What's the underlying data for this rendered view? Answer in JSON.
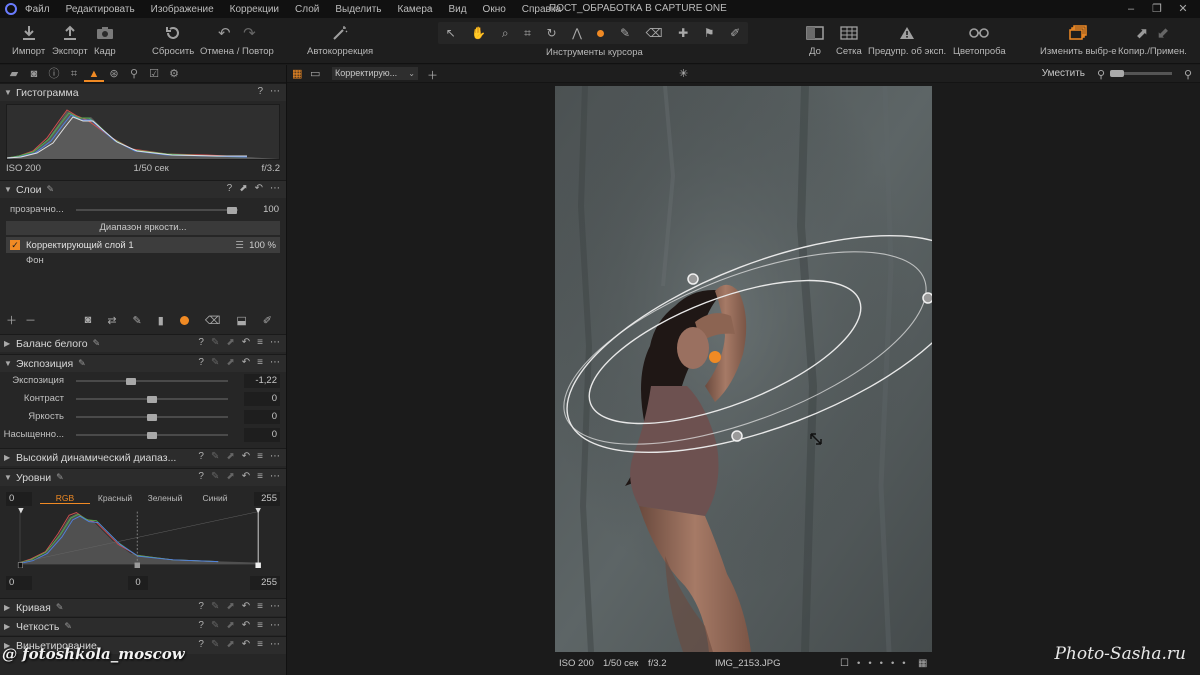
{
  "menu": {
    "items": [
      "Файл",
      "Редактировать",
      "Изображение",
      "Коррекции",
      "Слой",
      "Выделить",
      "Камера",
      "Вид",
      "Окно",
      "Справка"
    ],
    "window_title": "ПОСТ_ОБРАБОТКА В CAPTURE ONE",
    "window_controls": [
      "–",
      "❐",
      "✕"
    ]
  },
  "toolbar": {
    "import": "Импорт",
    "export": "Экспорт",
    "capture": "Кадр",
    "reset": "Сбросить",
    "undo_redo": "Отмена / Повтор",
    "autocorrect": "Автокоррекция",
    "cursor_tools": "Инструменты курсора",
    "before": "До",
    "grid": "Сетка",
    "exposure_warning": "Предупр. об эксп.",
    "color_readout": "Цветопроба",
    "edit_selected": "Изменить выбр-е",
    "copy_apply": "Копир./Примен."
  },
  "histogram": {
    "title": "Гистограмма",
    "iso": "ISO 200",
    "shutter": "1/50 сек",
    "aperture": "f/3.2"
  },
  "layers": {
    "title": "Слои",
    "opacity_label": "прозрачно...",
    "opacity_value": "100",
    "opacity_fraction": 0.96,
    "luma_range_button": "Диапазон яркости...",
    "layer_1_name": "Корректирующий слой 1",
    "layer_1_opacity": "100 %",
    "background_name": "Фон"
  },
  "white_balance": {
    "title": "Баланс белого"
  },
  "exposure": {
    "title": "Экспозиция",
    "rows": [
      {
        "label": "Экспозиция",
        "value": "-1,22",
        "fraction": 0.36
      },
      {
        "label": "Контраст",
        "value": "0",
        "fraction": 0.5
      },
      {
        "label": "Яркость",
        "value": "0",
        "fraction": 0.5
      },
      {
        "label": "Насыщенно...",
        "value": "0",
        "fraction": 0.5
      }
    ]
  },
  "hdr": {
    "title": "Высокий динамический диапаз..."
  },
  "levels": {
    "title": "Уровни",
    "input_left": "0",
    "input_right": "255",
    "tabs": [
      "RGB",
      "Красный",
      "Зеленый",
      "Синий"
    ],
    "active_tab": "RGB",
    "output_left": "0",
    "output_mid": "0",
    "output_right": "255"
  },
  "curve": {
    "title": "Кривая"
  },
  "clarity": {
    "title": "Четкость"
  },
  "vignetting": {
    "title": "Виньетирование"
  },
  "viewer": {
    "layer_selector": "Корректирую...",
    "fit_label": "Уместить"
  },
  "status": {
    "iso": "ISO 200",
    "shutter": "1/50 сек",
    "aperture": "f/3.2",
    "filename": "IMG_2153.JPG"
  },
  "watermarks": {
    "site": "Photo-Sasha.ru",
    "instagram": "@ fotoshkola_moscow"
  },
  "colors": {
    "accent": "#f08a24",
    "panel": "#262626",
    "background": "#1b1b1b"
  }
}
